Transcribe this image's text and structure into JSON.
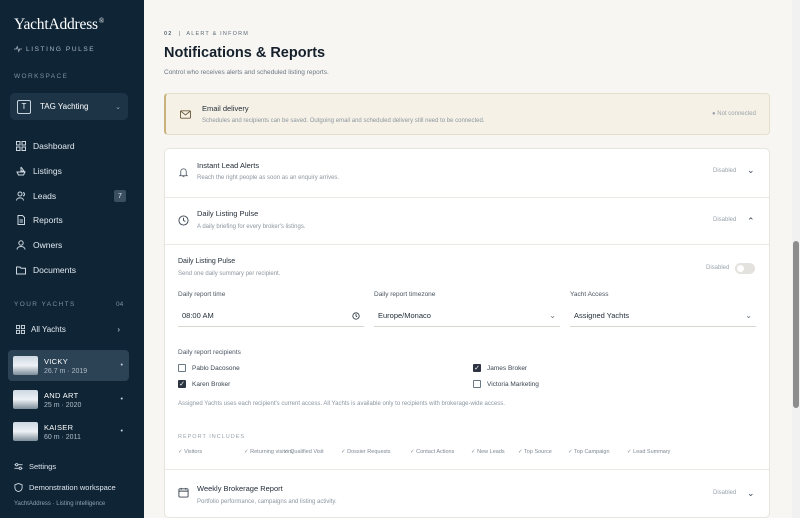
{
  "sidebar": {
    "brand": "YachtAddress",
    "brand_mark": "®",
    "tagline": "LISTING PULSE",
    "workspace_label": "WORKSPACE",
    "workspace": {
      "initial": "T",
      "name": "TAG Yachting"
    },
    "nav": [
      {
        "label": "Dashboard",
        "icon": "grid-icon"
      },
      {
        "label": "Listings",
        "icon": "boat-icon"
      },
      {
        "label": "Leads",
        "icon": "users-icon",
        "badge": "7"
      },
      {
        "label": "Reports",
        "icon": "document-icon"
      },
      {
        "label": "Owners",
        "icon": "user-icon"
      },
      {
        "label": "Documents",
        "icon": "folder-icon"
      }
    ],
    "yachts_label": "YOUR YACHTS",
    "yachts_count": "04",
    "all_yachts": "All Yachts",
    "yachts": [
      {
        "name": "VICKY",
        "detail": "26.7 m · 2019",
        "active": true
      },
      {
        "name": "AND ART",
        "detail": "25 m · 2020",
        "active": false
      },
      {
        "name": "KAISER",
        "detail": "60 m · 2011",
        "active": false
      }
    ],
    "settings": "Settings",
    "demo": "Demonstration workspace",
    "footer": "YachtAddress · Listing intelligence"
  },
  "main": {
    "section_num": "02",
    "section_label": "ALERT & INFORM",
    "title": "Notifications & Reports",
    "subtitle": "Control who receives alerts and scheduled listing reports.",
    "email": {
      "title": "Email delivery",
      "desc": "Schedules and recipients can be saved. Outgoing email and scheduled delivery still need to be connected.",
      "status": "● Not connected"
    },
    "instant": {
      "title": "Instant Lead Alerts",
      "desc": "Reach the right people as soon as an enquiry arrives.",
      "status": "Disabled"
    },
    "daily": {
      "title": "Daily Listing Pulse",
      "desc": "A daily briefing for every broker's listings.",
      "status": "Disabled",
      "inner_title": "Daily Listing Pulse",
      "inner_desc": "Send one daily summary per recipient.",
      "toggle_label": "Disabled",
      "time_label": "Daily report time",
      "time_value": "08:00 AM",
      "tz_label": "Daily report timezone",
      "tz_value": "Europe/Monaco",
      "access_label": "Yacht Access",
      "access_value": "Assigned Yachts",
      "recipients_label": "Daily report recipients",
      "recipients": [
        {
          "name": "Pablo Dacosone",
          "checked": false
        },
        {
          "name": "James Broker",
          "checked": true
        },
        {
          "name": "Karen Broker",
          "checked": true
        },
        {
          "name": "Victoria Marketing",
          "checked": false
        }
      ],
      "note": "Assigned Yachts uses each recipient's current access. All Yachts is available only to recipients with brokerage-wide access.",
      "includes_label": "REPORT INCLUDES",
      "includes": [
        "Visitors",
        "Returning visitors",
        "Qualified Visit",
        "Dossier Requests",
        "Contact Actions",
        "New Leads",
        "Top Source",
        "Top Campaign",
        "Lead Summary"
      ]
    },
    "weekly": {
      "title": "Weekly Brokerage Report",
      "desc": "Portfolio performance, campaigns and listing activity.",
      "status": "Disabled"
    }
  }
}
